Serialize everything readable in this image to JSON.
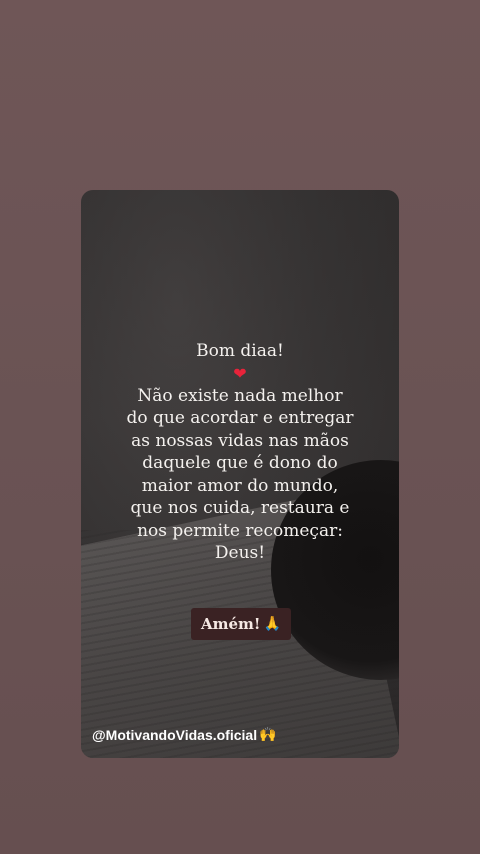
{
  "story": {
    "greeting": "Bom diaa!",
    "heart": "❤",
    "lines": [
      "Não existe nada melhor",
      "do que acordar e entregar",
      "as nossas vidas nas mãos",
      "daquele que é dono do",
      "maior amor do mundo,",
      "que nos cuida, restaura e",
      "nos permite recomeçar:",
      "Deus!"
    ],
    "sticker_label": "Amém!",
    "sticker_icon": "🙏",
    "handle": "@MotivandoVidas.oficial",
    "handle_icon": "🙌"
  },
  "colors": {
    "page_background": "#6a5354",
    "card_background": "#3b3838",
    "sticker_background": "#3a2223",
    "heart": "#e8233a"
  }
}
